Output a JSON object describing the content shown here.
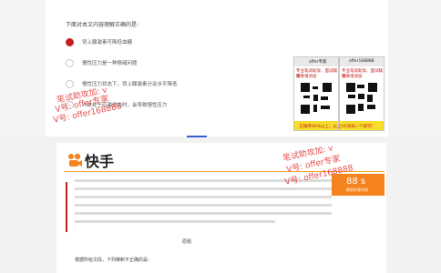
{
  "question": {
    "prompt": "下面对本文内容理解正确的是:",
    "options": [
      {
        "label": "肾上腺激素可降低血糖",
        "selected": true
      },
      {
        "label": "慢性压力是一种情绪问题",
        "selected": false
      },
      {
        "label": "慢性压力状态下，肾上腺激素分泌水平降低",
        "selected": false
      },
      {
        "label": "人体处于应激状态时，会导致慢性压力",
        "selected": false
      }
    ]
  },
  "qr_cards": [
    {
      "header": "offer专家",
      "line1": "专业笔试助攻、面试辅导",
      "line2": "需要请添加"
    },
    {
      "header": "offer168888",
      "line1": "专业笔试助攻、面试辅导",
      "line2": "需要请添加"
    }
  ],
  "banner": "正确率90%以上，以上VX添加一个即可!",
  "watermark_top": [
    "笔试助攻加: v",
    "V号: offer专家",
    "V号: offer168888"
  ],
  "watermark_bottom": [
    "笔试助攻加: v",
    "V号: offer专家",
    "V号: offer168888"
  ],
  "brand": {
    "name": "快手",
    "color": "#f5841f"
  },
  "timer": {
    "value": "88 s",
    "caption": "剩余作答时间"
  },
  "notes": {
    "bottom": "根据所给文段，下列推断不正确的是:",
    "mid": "原题"
  },
  "colors": {
    "accent": "#c0201e",
    "watermark": "#e03030",
    "banner_bg": "#f6dc2b"
  }
}
